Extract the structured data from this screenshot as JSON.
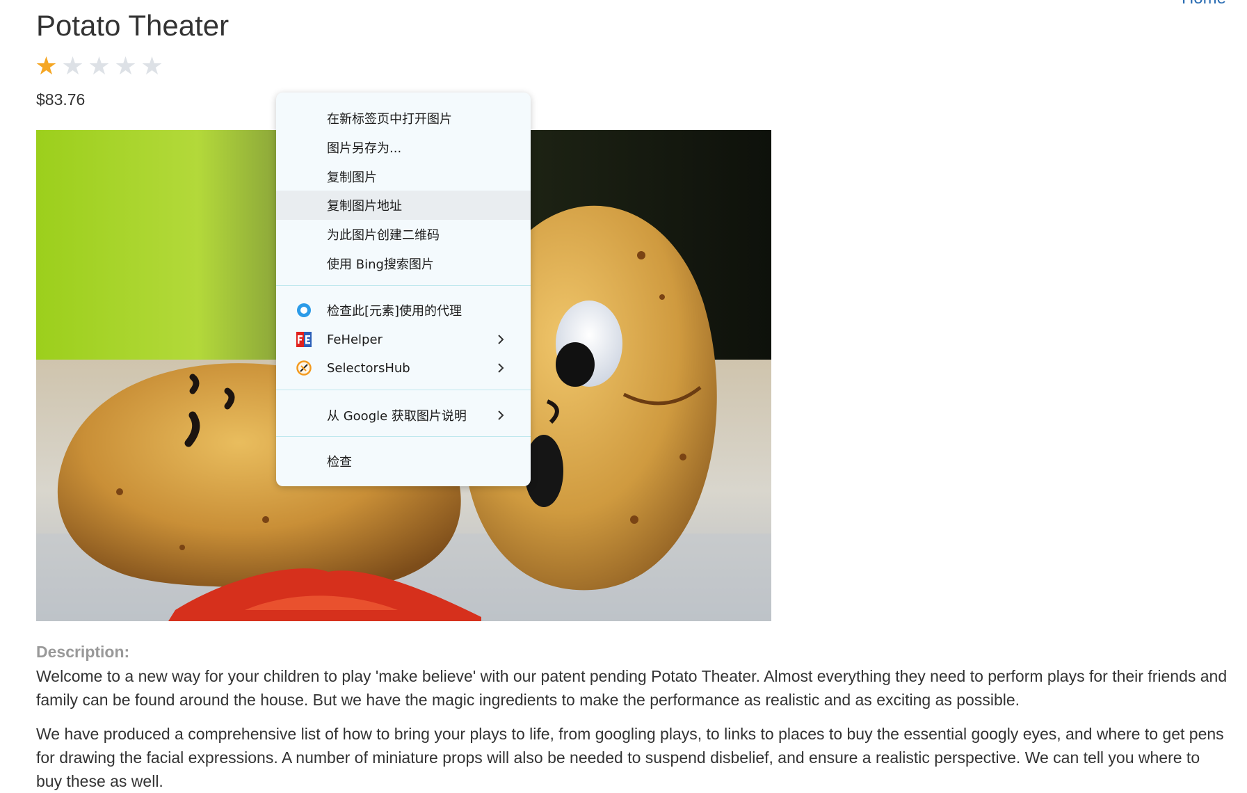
{
  "nav": {
    "home_label": "Home"
  },
  "product": {
    "title": "Potato Theater",
    "rating": 1,
    "rating_max": 5,
    "price": "$83.76"
  },
  "description": {
    "label": "Description:",
    "paragraphs": [
      "Welcome to a new way for your children to play 'make believe' with our patent pending Potato Theater. Almost everything they need to perform plays for their friends and family can be found around the house. But we have the magic ingredients to make the performance as realistic and as exciting as possible.",
      "We have produced a comprehensive list of how to bring your plays to life, from googling plays, to links to places to buy the essential googly eyes, and where to get pens for drawing the facial expressions. A number of miniature props will also be needed to suspend disbelief, and ensure a realistic perspective. We can tell you where to buy these as well."
    ]
  },
  "context_menu": {
    "items": [
      {
        "label": "在新标签页中打开图片"
      },
      {
        "label": "图片另存为..."
      },
      {
        "label": "复制图片"
      },
      {
        "label": "复制图片地址"
      },
      {
        "label": "为此图片创建二维码"
      },
      {
        "label": "使用 Bing搜索图片"
      },
      {
        "label": "检查此[元素]使用的代理",
        "icon": "proxy-circle-icon"
      },
      {
        "label": "FeHelper",
        "icon": "fehelper-icon"
      },
      {
        "label": "SelectorsHub",
        "icon": "selectorshub-icon"
      },
      {
        "label": "从 Google 获取图片说明"
      },
      {
        "label": "检查"
      }
    ],
    "highlighted_item": "复制图片地址"
  },
  "colors": {
    "star_filled": "#f5a623",
    "star_empty": "#dde1e6",
    "link": "#2a6db3",
    "menu_bg": "#f4fafd",
    "menu_hover": "#e9edf0",
    "menu_separator": "#bfe8ee"
  }
}
